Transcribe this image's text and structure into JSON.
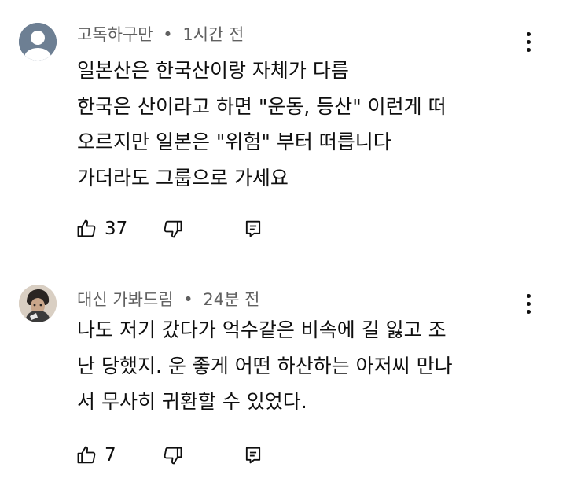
{
  "comments": [
    {
      "author": "고독하구만",
      "separator": "•",
      "time": "1시간 전",
      "lines": [
        "일본산은 한국산이랑 자체가 다름",
        "한국은 산이라고 하면 \"운동, 등산\" 이런게 떠",
        "오르지만 일본은 \"위험\" 부터 떠릅니다",
        "가더라도 그룹으로 가세요"
      ],
      "likes": "37",
      "avatar_icon": "default-person-avatar",
      "avatar_color": "#6d7f93"
    },
    {
      "author": "대신 가봐드림",
      "separator": "•",
      "time": "24분 전",
      "lines": [
        "나도 저기 갔다가 억수같은 비속에 길 잃고 조",
        "난 당했지. 운 좋게 어떤 하산하는 아저씨 만나",
        "서 무사히 귀환할 수 있었다."
      ],
      "likes": "7",
      "avatar_icon": "photo-avatar",
      "avatar_color": "#d9cfc3"
    }
  ],
  "icons": {
    "like": "thumbs-up-icon",
    "dislike": "thumbs-down-icon",
    "reply": "reply-icon",
    "more": "more-vert-icon"
  }
}
